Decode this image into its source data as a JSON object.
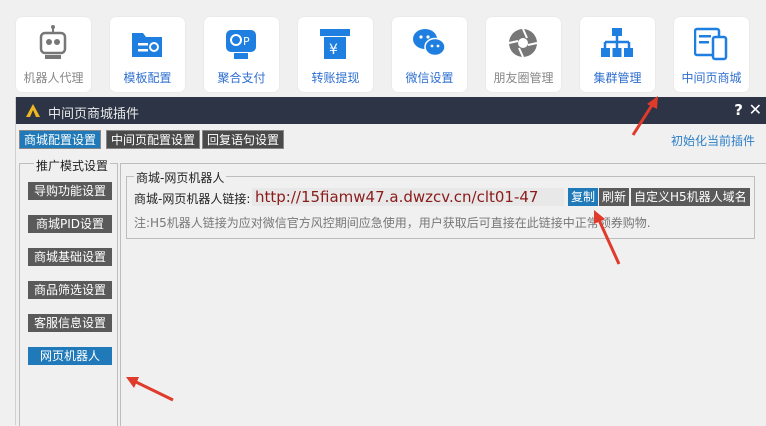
{
  "toolbar": {
    "tiles": [
      {
        "label": "机器人代理",
        "icon": "robot-icon"
      },
      {
        "label": "模板配置",
        "icon": "folder-settings-icon"
      },
      {
        "label": "聚合支付",
        "icon": "payment-icon"
      },
      {
        "label": "转账提现",
        "icon": "withdraw-icon"
      },
      {
        "label": "微信设置",
        "icon": "wechat-icon"
      },
      {
        "label": "朋友圈管理",
        "icon": "moments-icon"
      },
      {
        "label": "集群管理",
        "icon": "cluster-icon"
      },
      {
        "label": "中间页商城",
        "icon": "mall-icon"
      }
    ]
  },
  "dialog": {
    "title": "中间页商城插件",
    "help": "?",
    "close": "✕",
    "tabs": [
      "商城配置设置",
      "中间页配置设置",
      "回复语句设置"
    ],
    "init_link": "初始化当前插件",
    "sidebar": {
      "legend": "推广模式设置",
      "items": [
        "导购功能设置",
        "商城PID设置",
        "商城基础设置",
        "商品筛选设置",
        "客服信息设置",
        "网页机器人"
      ]
    },
    "group": {
      "legend": "商城-网页机器人",
      "field_label": "商城-网页机器人链接:",
      "url": "http://15fiamw47.a.dwzcv.cn/clt01-47",
      "copy": "复制",
      "refresh": "刷新",
      "custom_domain": "自定义H5机器人域名",
      "note": "注:H5机器人链接为应对微信官方风控期间应急使用，用户获取后可直接在此链接中正常领券购物."
    }
  },
  "colors": {
    "accent": "#2079b8",
    "titlebar": "#2c3445",
    "annotation": "#e03a2a",
    "icon_blue": "#1e7fe0"
  }
}
